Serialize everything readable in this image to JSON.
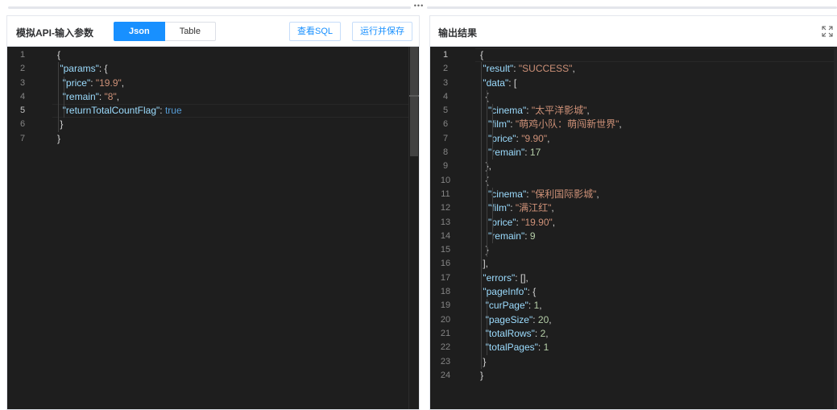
{
  "splitter": {
    "dots": "•••"
  },
  "input_panel": {
    "title": "模拟API-输入参数",
    "tabs": [
      {
        "label": "Json",
        "active": true
      },
      {
        "label": "Table",
        "active": false
      }
    ],
    "view_sql_label": "查看SQL",
    "run_save_label": "运行并保存",
    "current_line": 5,
    "code_lines": [
      [
        [
          "pun",
          "{"
        ]
      ],
      [
        [
          "pun",
          " "
        ],
        [
          "key",
          "\"params\""
        ],
        [
          "pun",
          ": {"
        ]
      ],
      [
        [
          "pun",
          "  "
        ],
        [
          "key",
          "\"price\""
        ],
        [
          "pun",
          ": "
        ],
        [
          "str",
          "\"19.9\""
        ],
        [
          "pun",
          ","
        ]
      ],
      [
        [
          "pun",
          "  "
        ],
        [
          "key",
          "\"remain\""
        ],
        [
          "pun",
          ": "
        ],
        [
          "str",
          "\"8\""
        ],
        [
          "pun",
          ","
        ]
      ],
      [
        [
          "pun",
          "  "
        ],
        [
          "key",
          "\"returnTotalCountFlag\""
        ],
        [
          "pun",
          ": "
        ],
        [
          "bool",
          "true"
        ]
      ],
      [
        [
          "pun",
          " }"
        ]
      ],
      [
        [
          "pun",
          "}"
        ]
      ]
    ]
  },
  "output_panel": {
    "title": "输出结果",
    "fullscreen_icon": "expand-icon",
    "current_line": 1,
    "code_lines": [
      [
        [
          "pun",
          "{"
        ]
      ],
      [
        [
          "pun",
          " "
        ],
        [
          "key",
          "\"result\""
        ],
        [
          "pun",
          ": "
        ],
        [
          "str",
          "\"SUCCESS\""
        ],
        [
          "pun",
          ","
        ]
      ],
      [
        [
          "pun",
          " "
        ],
        [
          "key",
          "\"data\""
        ],
        [
          "pun",
          ": ["
        ]
      ],
      [
        [
          "pun",
          "  {"
        ]
      ],
      [
        [
          "pun",
          "   "
        ],
        [
          "key",
          "\"cinema\""
        ],
        [
          "pun",
          ": "
        ],
        [
          "str",
          "\"太平洋影城\""
        ],
        [
          "pun",
          ","
        ]
      ],
      [
        [
          "pun",
          "   "
        ],
        [
          "key",
          "\"film\""
        ],
        [
          "pun",
          ": "
        ],
        [
          "str",
          "\"萌鸡小队：萌闯新世界\""
        ],
        [
          "pun",
          ","
        ]
      ],
      [
        [
          "pun",
          "   "
        ],
        [
          "key",
          "\"price\""
        ],
        [
          "pun",
          ": "
        ],
        [
          "str",
          "\"9.90\""
        ],
        [
          "pun",
          ","
        ]
      ],
      [
        [
          "pun",
          "   "
        ],
        [
          "key",
          "\"remain\""
        ],
        [
          "pun",
          ": "
        ],
        [
          "num",
          "17"
        ]
      ],
      [
        [
          "pun",
          "  },"
        ]
      ],
      [
        [
          "pun",
          "  {"
        ]
      ],
      [
        [
          "pun",
          "   "
        ],
        [
          "key",
          "\"cinema\""
        ],
        [
          "pun",
          ": "
        ],
        [
          "str",
          "\"保利国际影城\""
        ],
        [
          "pun",
          ","
        ]
      ],
      [
        [
          "pun",
          "   "
        ],
        [
          "key",
          "\"film\""
        ],
        [
          "pun",
          ": "
        ],
        [
          "str",
          "\"满江红\""
        ],
        [
          "pun",
          ","
        ]
      ],
      [
        [
          "pun",
          "   "
        ],
        [
          "key",
          "\"price\""
        ],
        [
          "pun",
          ": "
        ],
        [
          "str",
          "\"19.90\""
        ],
        [
          "pun",
          ","
        ]
      ],
      [
        [
          "pun",
          "   "
        ],
        [
          "key",
          "\"remain\""
        ],
        [
          "pun",
          ": "
        ],
        [
          "num",
          "9"
        ]
      ],
      [
        [
          "pun",
          "  }"
        ]
      ],
      [
        [
          "pun",
          " ],"
        ]
      ],
      [
        [
          "pun",
          " "
        ],
        [
          "key",
          "\"errors\""
        ],
        [
          "pun",
          ": [],"
        ]
      ],
      [
        [
          "pun",
          " "
        ],
        [
          "key",
          "\"pageInfo\""
        ],
        [
          "pun",
          ": {"
        ]
      ],
      [
        [
          "pun",
          "  "
        ],
        [
          "key",
          "\"curPage\""
        ],
        [
          "pun",
          ": "
        ],
        [
          "num",
          "1"
        ],
        [
          "pun",
          ","
        ]
      ],
      [
        [
          "pun",
          "  "
        ],
        [
          "key",
          "\"pageSize\""
        ],
        [
          "pun",
          ": "
        ],
        [
          "num",
          "20"
        ],
        [
          "pun",
          ","
        ]
      ],
      [
        [
          "pun",
          "  "
        ],
        [
          "key",
          "\"totalRows\""
        ],
        [
          "pun",
          ": "
        ],
        [
          "num",
          "2"
        ],
        [
          "pun",
          ","
        ]
      ],
      [
        [
          "pun",
          "  "
        ],
        [
          "key",
          "\"totalPages\""
        ],
        [
          "pun",
          ": "
        ],
        [
          "num",
          "1"
        ]
      ],
      [
        [
          "pun",
          " }"
        ]
      ],
      [
        [
          "pun",
          "}"
        ]
      ]
    ]
  }
}
